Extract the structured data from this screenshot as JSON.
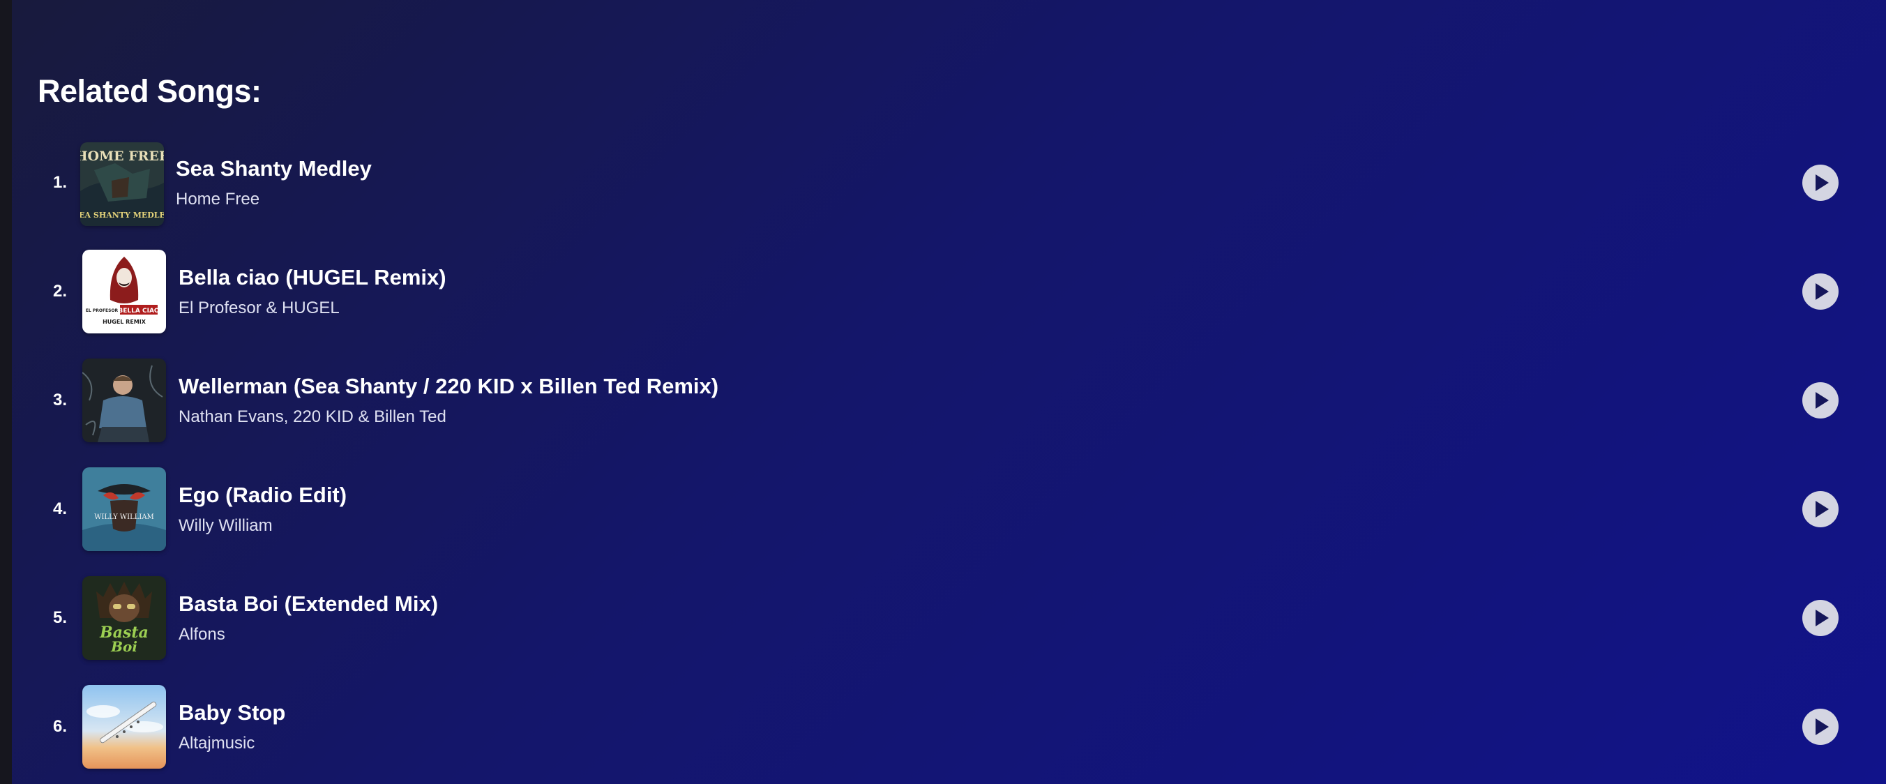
{
  "section": {
    "title": "Related Songs:"
  },
  "songs": [
    {
      "rank": "1.",
      "title": "Sea Shanty Medley",
      "artist": "Home Free",
      "cover_text": [
        "HOME FREE",
        "SEA SHANTY MEDLEY"
      ]
    },
    {
      "rank": "2.",
      "title": "Bella ciao (HUGEL Remix)",
      "artist": "El Profesor & HUGEL",
      "cover_text": [
        "EL PROFESOR",
        "BELLA CIAO",
        "HUGEL REMIX"
      ]
    },
    {
      "rank": "3.",
      "title": "Wellerman (Sea Shanty / 220 KID x Billen Ted Remix)",
      "artist": "Nathan Evans, 220 KID & Billen Ted"
    },
    {
      "rank": "4.",
      "title": "Ego (Radio Edit)",
      "artist": "Willy William",
      "cover_text": [
        "WILLY WILLIAM"
      ]
    },
    {
      "rank": "5.",
      "title": "Basta Boi (Extended Mix)",
      "artist": "Alfons",
      "cover_text": [
        "Basta",
        "Boi"
      ]
    },
    {
      "rank": "6.",
      "title": "Baby Stop",
      "artist": "Altajmusic"
    }
  ],
  "icons": {
    "play": "play-icon"
  },
  "colors": {
    "background_start": "#181a3c",
    "background_end": "#11138a",
    "play_button": "#d4d5e2",
    "play_glyph": "#15165a"
  }
}
